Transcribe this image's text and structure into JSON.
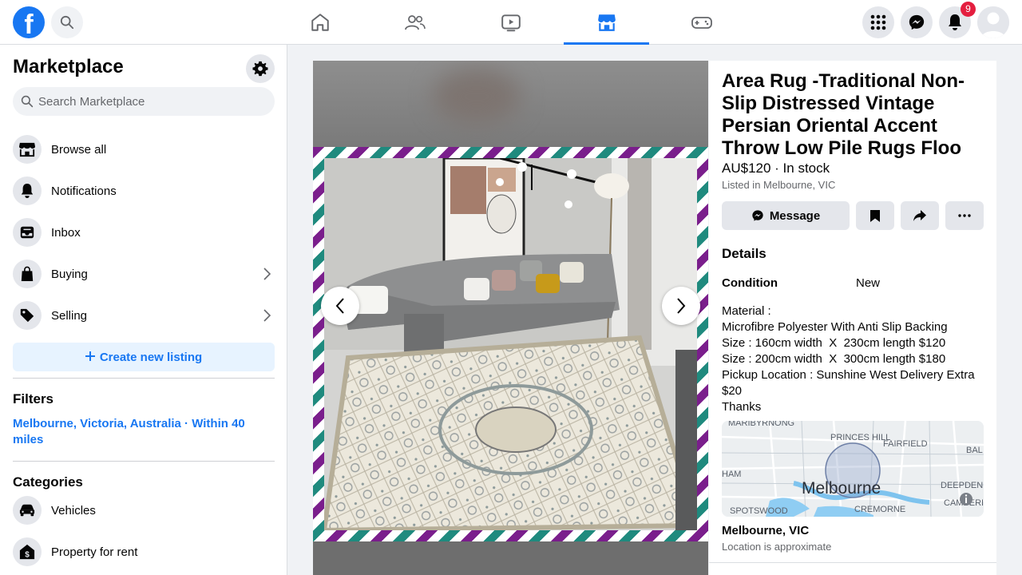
{
  "topbar": {
    "logo_letter": "f",
    "notifications_count": "9",
    "nav_tabs": [
      "Home",
      "Friends",
      "Watch",
      "Marketplace",
      "Gaming"
    ],
    "active_tab": "Marketplace"
  },
  "sidebar": {
    "title": "Marketplace",
    "search_placeholder": "Search Marketplace",
    "items": [
      {
        "label": "Browse all",
        "icon": "store-icon"
      },
      {
        "label": "Notifications",
        "icon": "bell-icon"
      },
      {
        "label": "Inbox",
        "icon": "inbox-icon"
      },
      {
        "label": "Buying",
        "icon": "shopping-bag-icon"
      },
      {
        "label": "Selling",
        "icon": "tag-icon"
      }
    ],
    "create_label": "Create new listing",
    "filters_heading": "Filters",
    "location_filter": "Melbourne, Victoria, Australia · Within 40 miles",
    "categories_heading": "Categories",
    "categories": [
      {
        "label": "Vehicles",
        "icon": "car-icon"
      },
      {
        "label": "Property for rent",
        "icon": "house-dollar-icon"
      }
    ]
  },
  "listing": {
    "title": "Area Rug -Traditional Non-Slip Distressed Vintage Persian Oriental Accent Throw Low Pile Rugs Floo",
    "price_status": "AU$120 · In stock",
    "listed": "Listed in Melbourne, VIC",
    "message_label": "Message",
    "details_heading": "Details",
    "condition_label": "Condition",
    "condition_value": "New",
    "description": [
      "Material :",
      "Microfibre Polyester With Anti Slip Backing",
      "Size : 160cm width  X  230cm length $120",
      "Size : 200cm width  X  300cm length $180",
      "Pickup Location : Sunshine West Delivery Extra $20",
      "Thanks"
    ],
    "map": {
      "city_label": "Melbourne",
      "places": [
        "MARIBYRNONG",
        "PRINCES HILL",
        "FAIRFIELD",
        "BAL NO",
        "HAM",
        "DEEPDENE",
        "SPOTSWOOD",
        "CREMORNE",
        "CAMBERI"
      ]
    },
    "location": "Melbourne, VIC",
    "location_note": "Location is approximate"
  },
  "colors": {
    "brand": "#1877f2",
    "badge": "#e41e3f"
  }
}
